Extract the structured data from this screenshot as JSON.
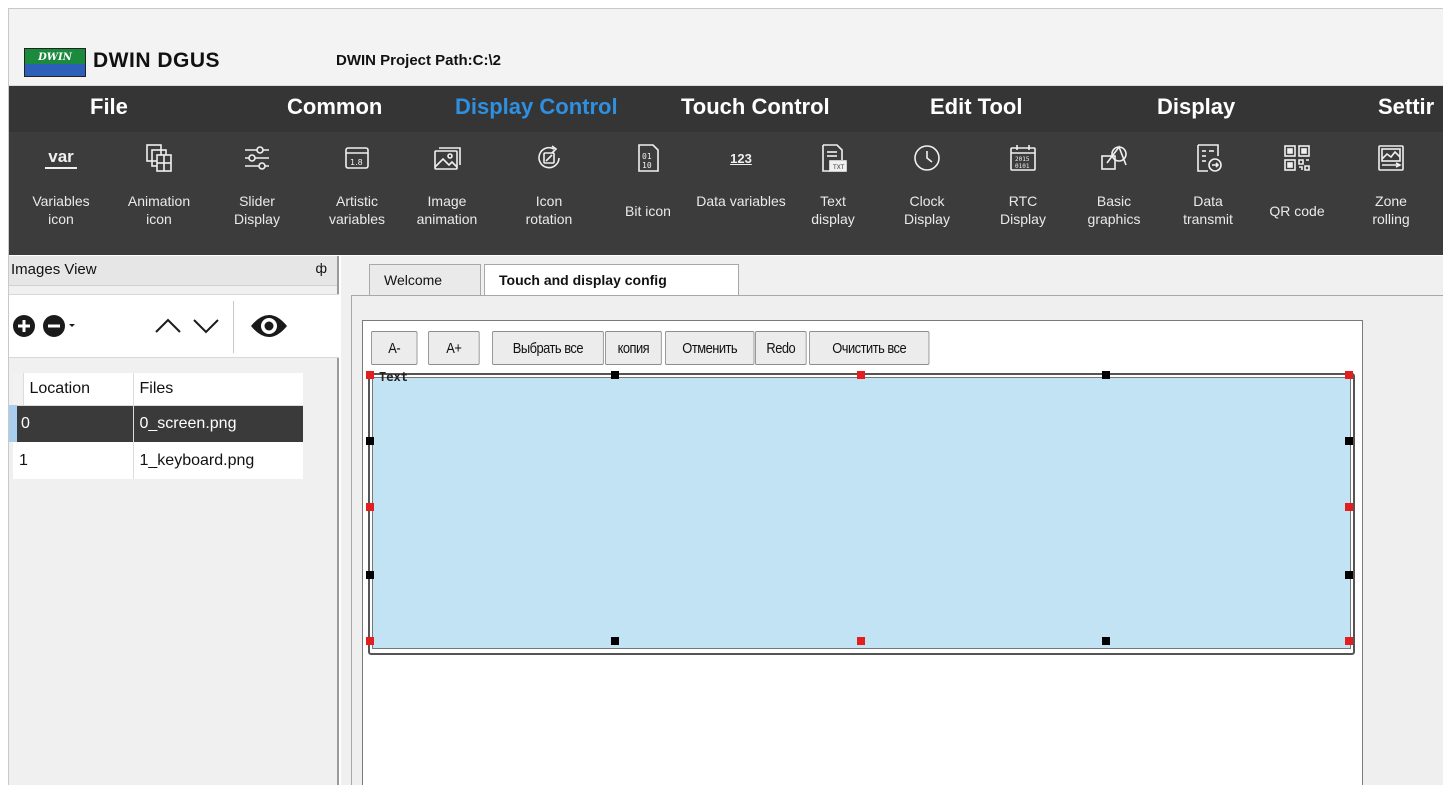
{
  "app": {
    "title": "DWIN DGUS",
    "project_path": "DWIN Project Path:C:\\2",
    "logo_text": "DWIN"
  },
  "menu": [
    {
      "label": "File",
      "active": false
    },
    {
      "label": "Common",
      "active": false
    },
    {
      "label": "Display Control",
      "active": true
    },
    {
      "label": "Touch Control",
      "active": false
    },
    {
      "label": "Edit Tool",
      "active": false
    },
    {
      "label": "Display",
      "active": false
    },
    {
      "label": "Settir",
      "active": false
    }
  ],
  "tools": [
    {
      "label": "Variables icon",
      "icon": "var-icon"
    },
    {
      "label": "Animation icon",
      "icon": "animation-icon"
    },
    {
      "label": "Slider Display",
      "icon": "slider-icon"
    },
    {
      "label": "Artistic variables",
      "icon": "artistic-variables-icon"
    },
    {
      "label": "Image animation",
      "icon": "image-animation-icon"
    },
    {
      "label": "Icon rotation",
      "icon": "icon-rotation-icon"
    },
    {
      "label": "Bit icon",
      "icon": "bit-icon"
    },
    {
      "label": "Data variables",
      "icon": "data-variables-icon"
    },
    {
      "label": "Text display",
      "icon": "text-display-icon"
    },
    {
      "label": "Clock Display",
      "icon": "clock-icon"
    },
    {
      "label": "RTC Display",
      "icon": "rtc-icon"
    },
    {
      "label": "Basic graphics",
      "icon": "basic-graphics-icon"
    },
    {
      "label": "Data transmit",
      "icon": "data-transmit-icon"
    },
    {
      "label": "QR code",
      "icon": "qr-code-icon"
    },
    {
      "label": "Zone rolling",
      "icon": "zone-rolling-icon"
    }
  ],
  "images_view": {
    "title": "Images View",
    "pin": "ф",
    "columns": [
      "Location",
      "Files"
    ],
    "rows": [
      {
        "location": "0",
        "file": "0_screen.png",
        "selected": true
      },
      {
        "location": "1",
        "file": "1_keyboard.png",
        "selected": false
      }
    ]
  },
  "tabs": [
    {
      "label": "Welcome",
      "active": false
    },
    {
      "label": "Touch and display config",
      "active": true
    }
  ],
  "edit_buttons": [
    "A-",
    "A+",
    "Выбрать все",
    "копия",
    "Отменить",
    "Redo",
    "Очистить все"
  ],
  "editor": {
    "control_label": "Text",
    "selected_fill": "#c2e3f3"
  }
}
